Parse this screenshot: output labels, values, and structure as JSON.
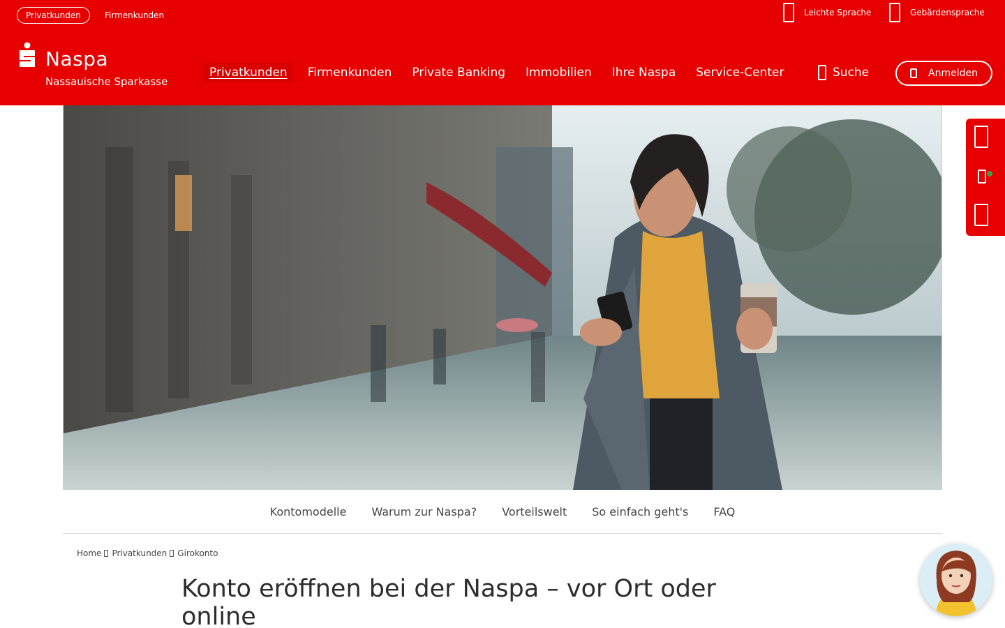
{
  "topbar": {
    "segments": {
      "active": "Privatkunden",
      "other": "Firmenkunden"
    },
    "accessibility": {
      "easy_language": "Leichte Sprache",
      "sign_language": "Gebärdensprache"
    }
  },
  "brand": {
    "name": "Naspa",
    "full_name": "Nassauische Sparkasse"
  },
  "main_nav": [
    "Privatkunden",
    "Firmenkunden",
    "Private Banking",
    "Immobilien",
    "Ihre Naspa",
    "Service-Center"
  ],
  "search_label": "Suche",
  "login_label": "Anmelden",
  "anchor_nav": [
    "Kontomodelle",
    "Warum zur Naspa?",
    "Vorteilswelt",
    "So einfach geht's",
    "FAQ"
  ],
  "breadcrumb": [
    "Home",
    "Privatkunden",
    "Girokonto"
  ],
  "page_title": "Konto eröffnen bei der Naspa – vor Ort oder online",
  "colors": {
    "brand_red": "#e60000",
    "online_status": "#3aa14a"
  }
}
